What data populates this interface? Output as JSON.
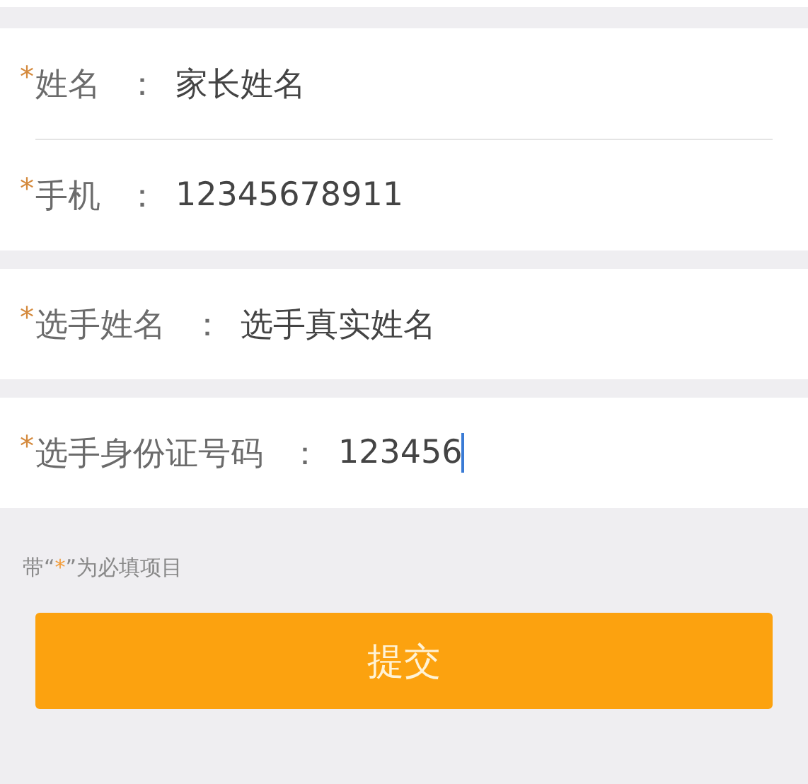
{
  "groups": [
    {
      "fields": [
        {
          "mark": "*",
          "label": "姓名",
          "separator": "：",
          "value": "家长姓名",
          "focused": false
        },
        {
          "mark": "*",
          "label": "手机",
          "separator": "：",
          "value": "12345678911",
          "focused": false
        }
      ]
    },
    {
      "fields": [
        {
          "mark": "*",
          "label": "选手姓名",
          "separator": "：",
          "value": "选手真实姓名",
          "focused": false
        }
      ]
    },
    {
      "fields": [
        {
          "mark": "*",
          "label": "选手身份证号码",
          "separator": "：",
          "value": "123456",
          "focused": true
        }
      ]
    }
  ],
  "note": {
    "before": "带“",
    "mark": "*",
    "after": "”为必填项目"
  },
  "submit_button": "提交"
}
